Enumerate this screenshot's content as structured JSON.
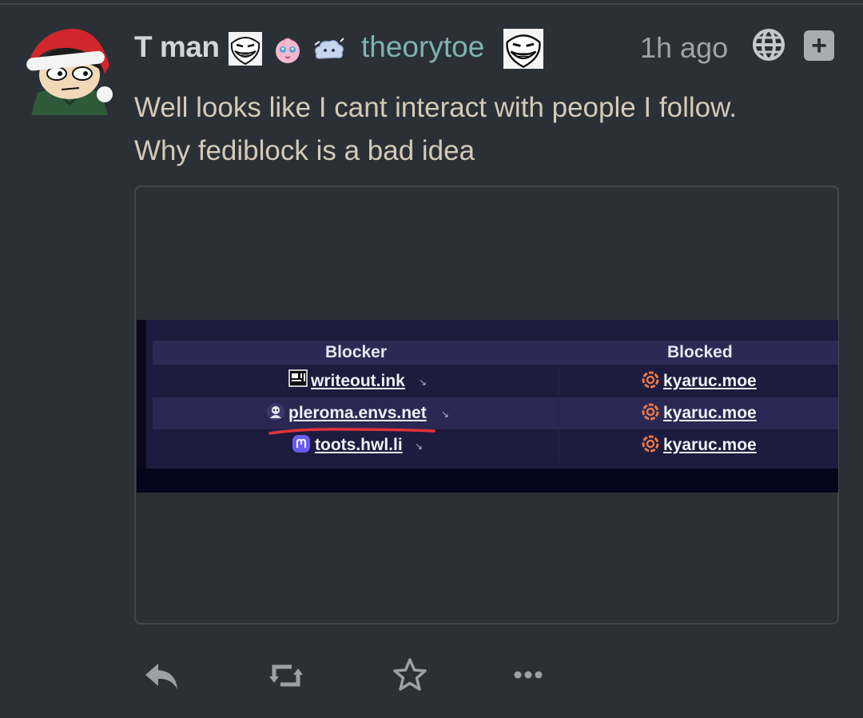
{
  "post": {
    "display_name": "T man",
    "handle": "theorytoe",
    "timestamp": "1h ago",
    "text_lines": [
      "Well looks like I cant interact with people I follow.",
      "Why fediblock is a bad idea"
    ],
    "emojis": [
      "trollface-emoji",
      "jigglypuff-emoji",
      "cloud-creature-emoji",
      "trollface-emoji"
    ]
  },
  "attachment": {
    "table": {
      "headers": {
        "blocker": "Blocker",
        "blocked": "Blocked"
      },
      "rows": [
        {
          "blocker": "writeout.ink",
          "blocker_icon": "writeout-icon",
          "blocked": "kyaruc.moe",
          "blocked_icon": "misskey-icon"
        },
        {
          "blocker": "pleroma.envs.net",
          "blocker_icon": "pleroma-icon",
          "blocked": "kyaruc.moe",
          "blocked_icon": "misskey-icon"
        },
        {
          "blocker": "toots.hwl.li",
          "blocker_icon": "mastodon-icon",
          "blocked": "kyaruc.moe",
          "blocked_icon": "misskey-icon"
        }
      ]
    },
    "highlight_color": "#e0333a"
  },
  "actions": [
    "reply-icon",
    "boost-icon",
    "favourite-icon",
    "more-icon"
  ],
  "colors": {
    "background": "#2b3036",
    "text": "#d4cab8",
    "handle": "#7fb3b4",
    "muted": "#9ea3a9"
  }
}
